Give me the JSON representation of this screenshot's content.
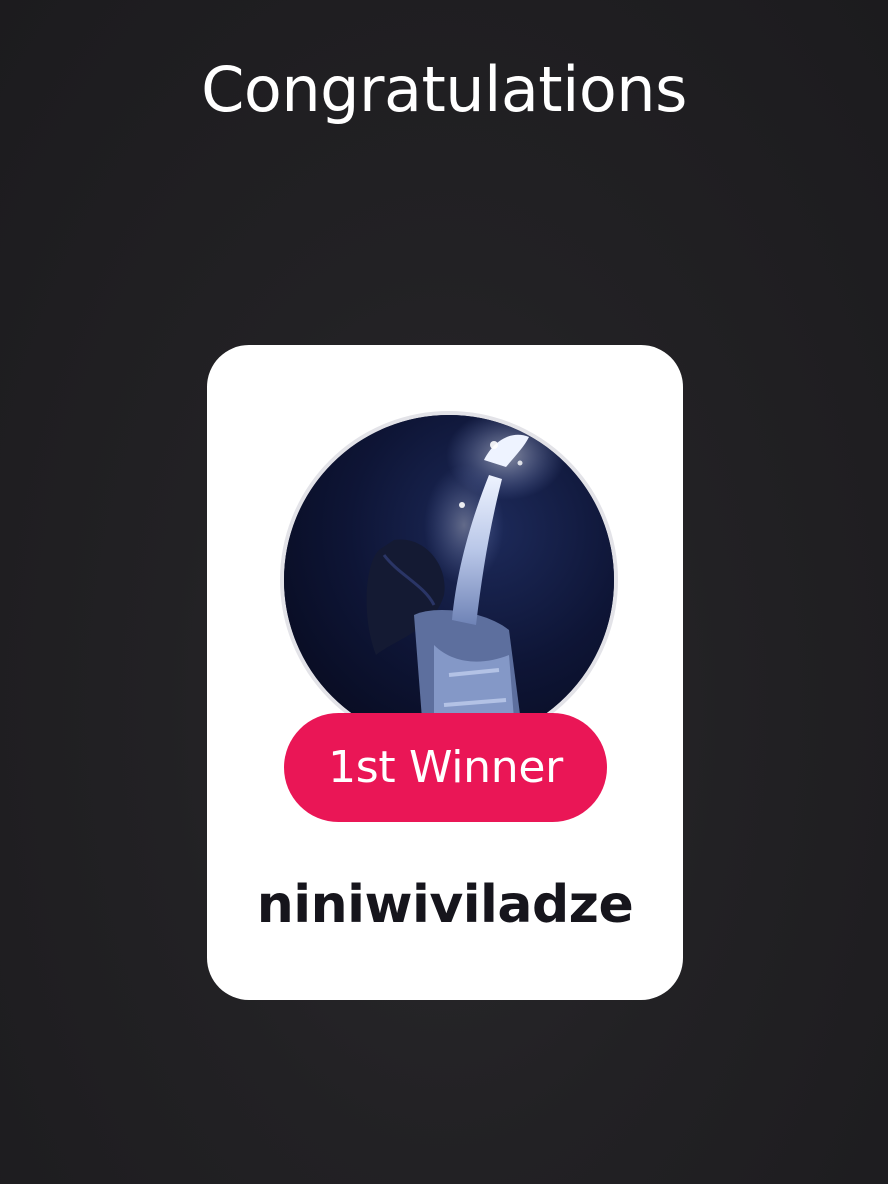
{
  "header": {
    "title": "Congratulations"
  },
  "winner_card": {
    "avatar_icon": "user-avatar-photo",
    "rank_label": "1st Winner",
    "username": "niniwiviladze"
  },
  "colors": {
    "background": "#222124",
    "card": "#ffffff",
    "badge": "#ea1656",
    "username_text": "#16151c"
  }
}
